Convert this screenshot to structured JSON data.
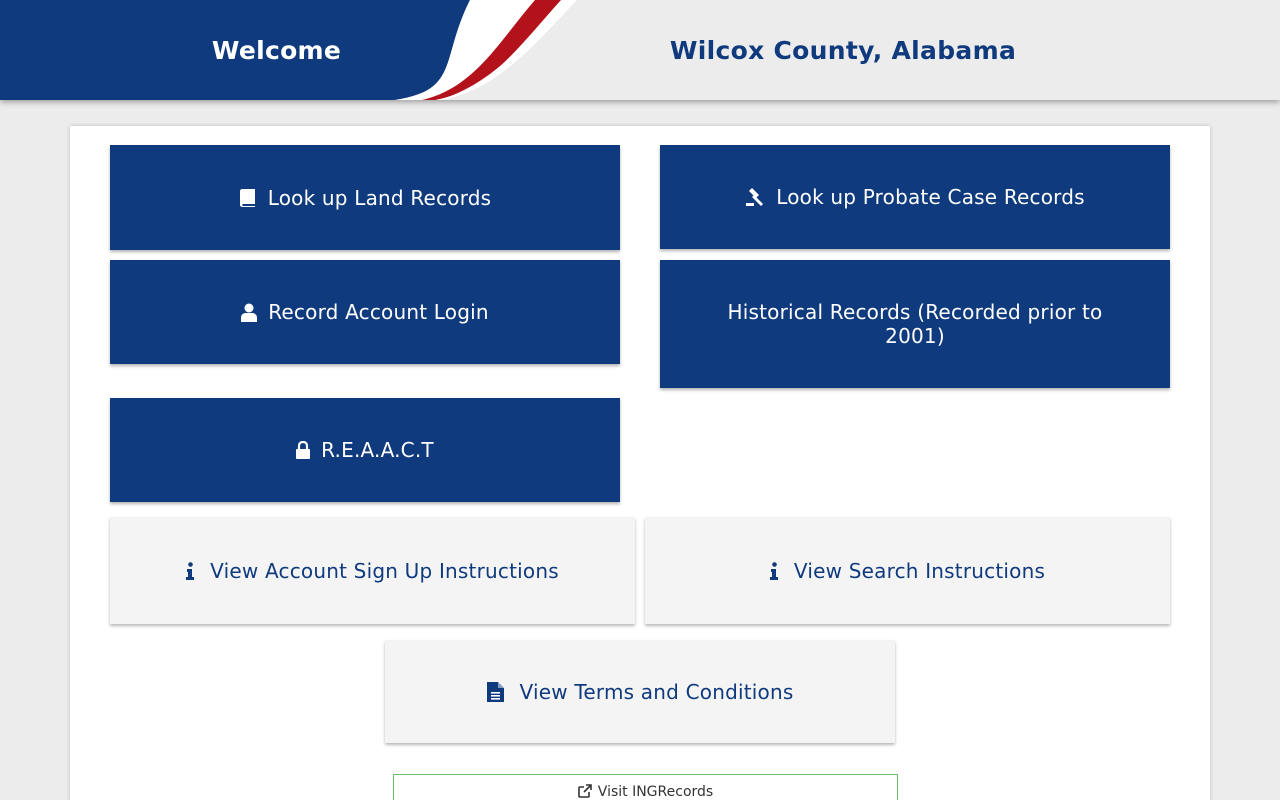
{
  "header": {
    "welcome": "Welcome",
    "county": "Wilcox County, Alabama"
  },
  "buttons": {
    "land_records": {
      "label": "Look up Land Records",
      "icon": "book-icon"
    },
    "probate_records": {
      "label": "Look up Probate Case Records",
      "icon": "gavel-icon"
    },
    "account_login": {
      "label": "Record Account Login",
      "icon": "user-icon"
    },
    "historical_records": {
      "label": "Historical Records (Recorded prior to 2001)"
    },
    "reaact": {
      "label": "R.E.A.A.C.T",
      "icon": "lock-icon"
    },
    "signup_instructions": {
      "label": "View Account Sign Up Instructions",
      "icon": "info-icon"
    },
    "search_instructions": {
      "label": "View Search Instructions",
      "icon": "info-icon"
    },
    "terms": {
      "label": "View Terms and Conditions",
      "icon": "document-icon"
    },
    "visit_ingrecords": {
      "label": "Visit INGRecords",
      "icon": "external-link-icon"
    }
  },
  "colors": {
    "primary_blue": "#0f3a7e",
    "swoosh_red": "#b3121a",
    "background": "#ececec",
    "outline_green": "#6cc06c"
  }
}
